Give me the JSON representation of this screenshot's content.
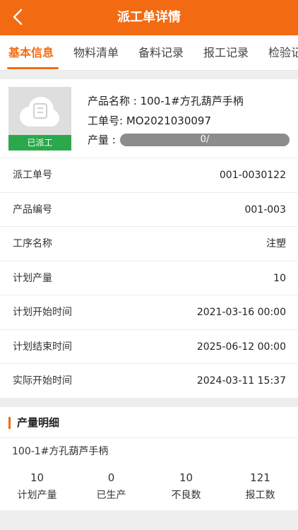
{
  "header": {
    "title": "派工单详情",
    "back_icon": "chevron-left-icon"
  },
  "tabs": [
    {
      "label": "基本信息",
      "active": true
    },
    {
      "label": "物料清单"
    },
    {
      "label": "备料记录"
    },
    {
      "label": "报工记录"
    },
    {
      "label": "检验记录"
    }
  ],
  "product": {
    "name_label": "产品名称 : ",
    "name": "100-1#方孔葫芦手柄",
    "order_label": "工单号:  ",
    "order": "MO2021030097",
    "qty_label": "产量 : ",
    "progress_text": "0/",
    "progress": 0,
    "status": "已派工",
    "status_color": "#2aa84a",
    "image_icon": "cloud-image-icon"
  },
  "fields": [
    {
      "label": "派工单号",
      "value": "001-0030122"
    },
    {
      "label": "产品编号",
      "value": "001-003"
    },
    {
      "label": "工序名称",
      "value": "注塑"
    },
    {
      "label": "计划产量",
      "value": "10"
    },
    {
      "label": "计划开始时间",
      "value": "2021-03-16 00:00"
    },
    {
      "label": "计划结束时间",
      "value": "2025-06-12 00:00"
    },
    {
      "label": "实际开始时间",
      "value": "2024-03-11 15:37"
    }
  ],
  "detail": {
    "title": "产量明细",
    "product_name": "100-1#方孔葫芦手柄",
    "stats": [
      {
        "value": "10",
        "label": "计划产量"
      },
      {
        "value": "0",
        "label": "已生产"
      },
      {
        "value": "10",
        "label": "不良数"
      },
      {
        "value": "121",
        "label": "报工数"
      }
    ]
  },
  "colors": {
    "accent": "#f26b12",
    "progress_track": "#8c8c8c"
  }
}
